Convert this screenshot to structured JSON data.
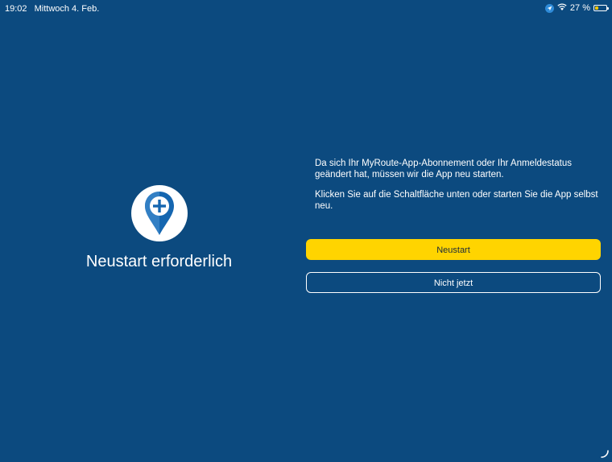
{
  "status_bar": {
    "time": "19:02",
    "date": "Mittwoch 4. Feb.",
    "battery": "27 %",
    "battery_level": 0.27,
    "icons": [
      "location-icon",
      "wifi-icon",
      "battery-icon"
    ]
  },
  "dialog": {
    "title": "Neustart erforderlich",
    "message_1": "Da sich Ihr MyRoute-App-Abonnement oder Ihr Anmeldestatus geändert hat, müssen wir die App neu starten.",
    "message_2": "Klicken Sie auf die Schaltfläche unten oder starten Sie die App selbst neu.",
    "primary_button": "Neustart",
    "secondary_button": "Nicht jetzt",
    "logo_icon": "map-pin-plus-icon"
  },
  "colors": {
    "background": "#0c4a7f",
    "primary_button": "#ffd400",
    "logo_blue": "#1566b0"
  }
}
